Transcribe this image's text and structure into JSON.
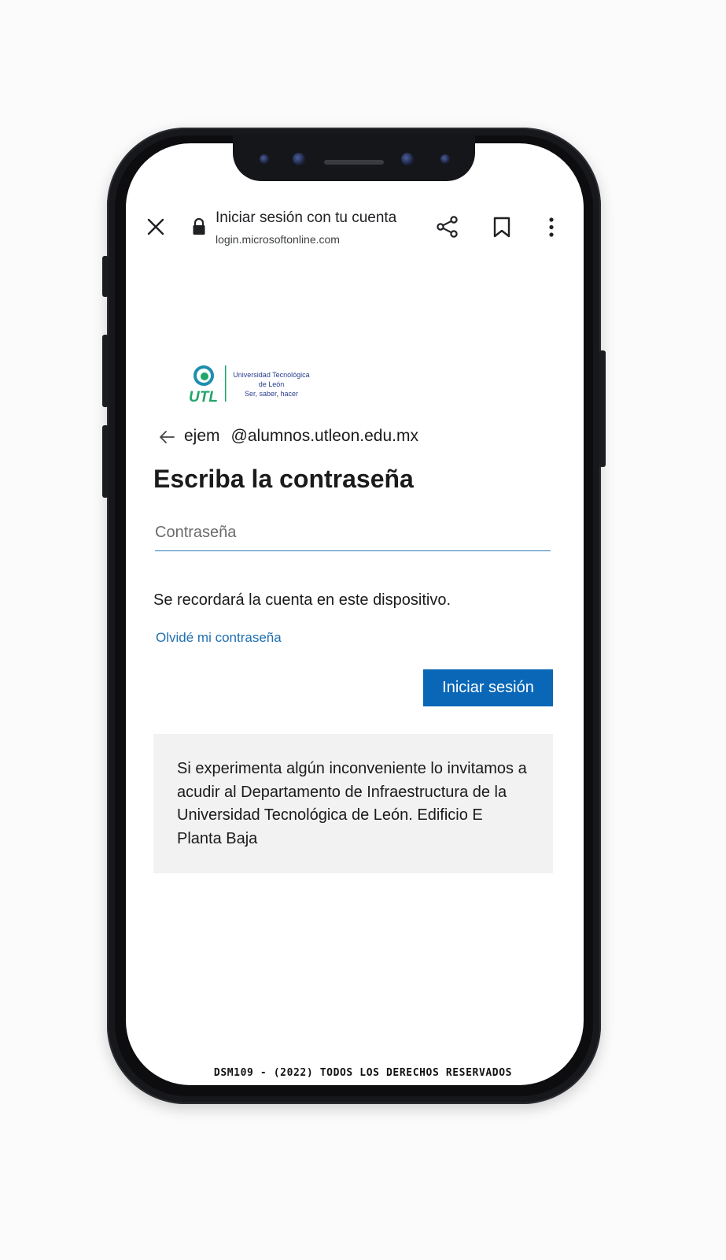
{
  "browser": {
    "page_title": "Iniciar sesión con tu cuenta",
    "url": "login.microsoftonline.com",
    "icons": {
      "close": "close-icon",
      "lock": "lock-icon",
      "share": "share-icon",
      "bookmark": "bookmark-icon",
      "menu": "more-vert-icon"
    }
  },
  "logo": {
    "line1": "Universidad Tecnológica",
    "line2": "de León",
    "line3": "Ser, saber, hacer",
    "mark_text": "UTL",
    "colors": {
      "green": "#1fa66a",
      "blue": "#2a3f8f",
      "teal": "#1f8fb0"
    }
  },
  "signin": {
    "username": "ejem",
    "domain": "@alumnos.utleon.edu.mx",
    "heading": "Escriba la contraseña",
    "password_placeholder": "Contraseña",
    "password_value": "",
    "remember_text": "Se recordará la cuenta en este dispositivo.",
    "forgot_link": "Olvidé mi contraseña",
    "submit_label": "Iniciar sesión",
    "notice": "Si experimenta algún inconveniente lo invitamos a acudir al Departamento de Infraestructura de la Universidad Tecnológica de León. Edificio E Planta Baja"
  },
  "theme": {
    "accent": "#0a67b8",
    "link": "#1f6fb0",
    "notice_bg": "#f2f2f2"
  },
  "footer": {
    "text": "DSM109 - (2022) TODOS LOS DERECHOS RESERVADOS"
  }
}
